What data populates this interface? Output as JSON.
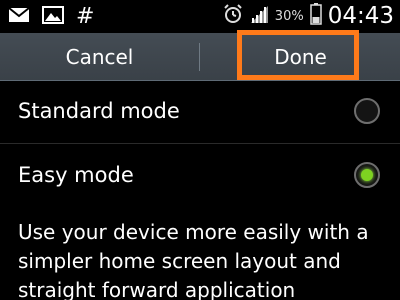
{
  "status_bar": {
    "left_icons": [
      "mail-icon",
      "image-icon",
      "hash-icon"
    ],
    "hash_symbol": "#",
    "right_icons": [
      "alarm-icon",
      "signal-icon",
      "battery-icon"
    ],
    "battery_percent": "30%",
    "time": "04:43"
  },
  "action_bar": {
    "cancel_label": "Cancel",
    "done_label": "Done",
    "highlight_color": "#ff7a1a"
  },
  "modes": {
    "standard": {
      "label": "Standard mode",
      "selected": false
    },
    "easy": {
      "label": "Easy mode",
      "selected": true
    }
  },
  "description": "Use your device more easily with a simpler home screen layout and straight forward application",
  "colors": {
    "action_bar": "#40474e",
    "radio_selected": "#7ed321",
    "text": "#ffffff"
  }
}
